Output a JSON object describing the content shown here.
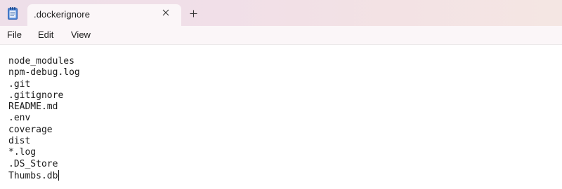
{
  "app": {
    "icon": "notepad-icon"
  },
  "tab": {
    "title": ".dockerignore",
    "close_icon": "close-icon",
    "new_tab_icon": "plus-icon"
  },
  "menu": {
    "file": "File",
    "edit": "Edit",
    "view": "View"
  },
  "editor": {
    "lines": [
      "node_modules",
      "npm-debug.log",
      ".git",
      ".gitignore",
      "README.md",
      ".env",
      "coverage",
      "dist",
      "*.log",
      ".DS_Store",
      "Thumbs.db"
    ]
  },
  "colors": {
    "titlebar": "#f0dfe8",
    "tab": "#fbf6f8",
    "icon_blue": "#3a7bd5"
  }
}
